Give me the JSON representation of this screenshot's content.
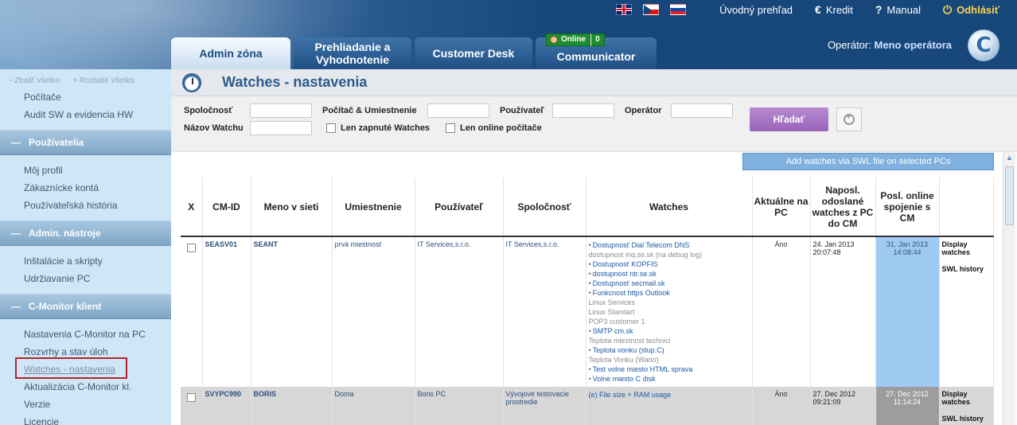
{
  "header": {
    "flags": [
      "flag-en",
      "flag-cz",
      "flag-sk"
    ],
    "nav": [
      {
        "label": "Úvodný prehľad",
        "icon": ""
      },
      {
        "label": "Kredit",
        "icon": "€"
      },
      {
        "label": "Manual",
        "icon": "?"
      },
      {
        "label": "Odhlásiť",
        "icon": "⏻"
      }
    ],
    "tabs": [
      {
        "label": "Admin zóna"
      },
      {
        "label": "Prehliadanie a Vyhodnotenie"
      },
      {
        "label": "Customer Desk"
      },
      {
        "label": "Communicator"
      }
    ],
    "online_badge": {
      "label": "Online",
      "count": "0"
    },
    "operator_label": "Operátor:",
    "operator_name": "Meno operátora",
    "logo_letter": "C"
  },
  "sidebar": {
    "collapse_all": "- Zbaliť všetko",
    "expand_all": "+ Rozbaliť všetko",
    "items_top": [
      "Počítače",
      "Audit SW a evidencia HW"
    ],
    "sections": [
      {
        "title": "Používatelia",
        "items": [
          "Môj profil",
          "Zákaznícke kontá",
          "Používateľská história"
        ]
      },
      {
        "title": "Admin. nástroje",
        "items": [
          "Inštalácie a skripty",
          "Udržiavanie PC"
        ]
      },
      {
        "title": "C-Monitor klient",
        "items": [
          "Nastavenia C-Monitor na PC",
          "Rozvrhy a stav úloh",
          "Watches - nastavenia",
          "Aktualizácia C-Monitor kl.",
          "Verzie",
          "Licencie"
        ]
      }
    ]
  },
  "main": {
    "title": "Watches - nastavenia",
    "filter": {
      "company": "Spoločnosť",
      "computer": "Počítač & Umiestnenie",
      "user": "Používateľ",
      "operator": "Operátor",
      "watch_name": "Názov Watchu",
      "only_enabled": "Len zapnuté Watches",
      "only_online": "Len online počítače",
      "search": "Hľadať"
    },
    "swl_button": "Add watches via SWL file on selected PCs",
    "columns": [
      "X",
      "CM-ID",
      "Meno v sieti",
      "Umiestnenie",
      "Používateľ",
      "Spoločnosť",
      "Watches",
      "Aktuálne na PC",
      "Naposl. odoslané watches z PC do CM",
      "Posl. online spojenie s CM",
      ""
    ],
    "rows": [
      {
        "cm_id": "SEASV01",
        "name": "SEANT",
        "location": "prvá miestnosť",
        "user": "IT Services,s.r.o.",
        "company": "IT Services,s.r.o.",
        "watches": [
          {
            "text": "Dostupnosť Dial Telecom DNS",
            "on": true
          },
          {
            "text": "dostupnost inq.se.sk (na debug log)",
            "on": false
          },
          {
            "text": "Dostupnosť KOPFIS",
            "on": true
          },
          {
            "text": "dostupnost ntr.se.sk",
            "on": true
          },
          {
            "text": "Dostupnosť secmail.sk",
            "on": true
          },
          {
            "text": "Funkcnost https Outlook",
            "on": true
          },
          {
            "text": "Linux Services",
            "on": false
          },
          {
            "text": "Linux Standart",
            "on": false
          },
          {
            "text": "POP3 customer 1",
            "on": false
          },
          {
            "text": "SMTP cm.sk",
            "on": true
          },
          {
            "text": "Teplota miestnost technici",
            "on": false
          },
          {
            "text": "Teplota vonku (stup.C)",
            "on": true
          },
          {
            "text": "Teplota Vonku (Wario)",
            "on": false
          },
          {
            "text": "Test volne miesto HTML sprava",
            "on": true
          },
          {
            "text": "Volne miesto C disk",
            "on": true
          }
        ],
        "current": "Áno",
        "sent_date": "24. Jan 2013",
        "sent_time": "20:07:48",
        "online_date": "31. Jan 2013",
        "online_time": "14:08:44",
        "actions": [
          "Display watches",
          "SWL history"
        ]
      },
      {
        "cm_id": "SVYPC990",
        "name": "BORIS",
        "location": "Doma",
        "user": "Boris PC",
        "company": "Vývojové testovacie prostredie",
        "watches": [
          {
            "text": "(e) File size + RAM usage",
            "on": true,
            "plain": true
          }
        ],
        "current": "Áno",
        "sent_date": "27. Dec 2012",
        "sent_time": "09:21:09",
        "online_date": "27. Dec 2012",
        "online_time": "11:14:24",
        "actions": [
          "Display watches",
          "SWL history"
        ]
      }
    ]
  }
}
